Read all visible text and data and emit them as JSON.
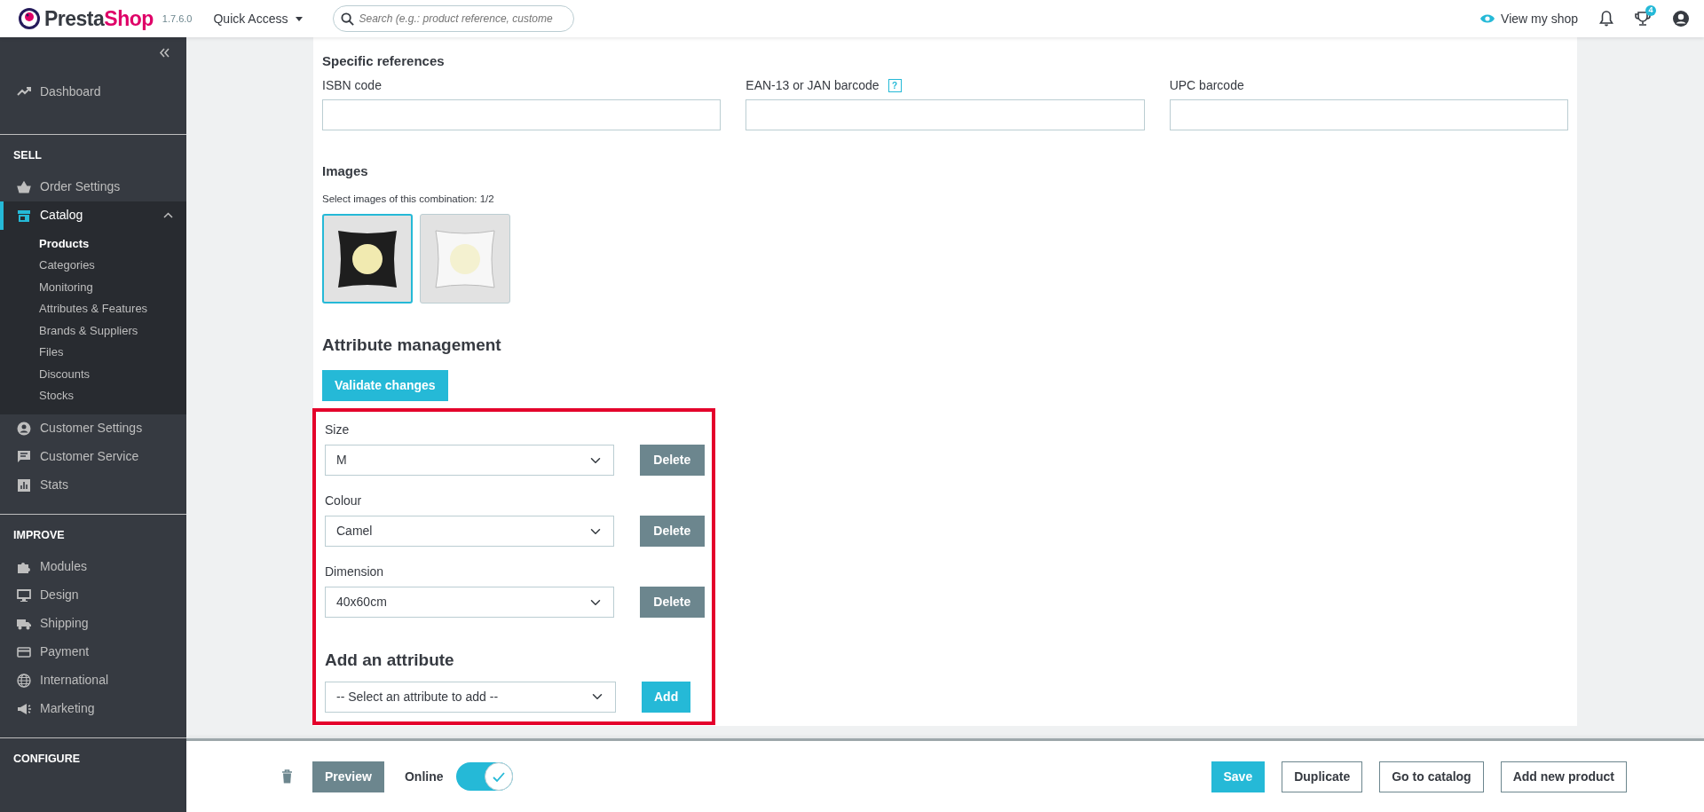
{
  "header": {
    "logo_text": "PrestaShop",
    "version": "1.7.6.0",
    "quick_access": "Quick Access",
    "search_placeholder": "Search (e.g.: product reference, custome",
    "view_shop": "View my shop",
    "trophy_count": "4"
  },
  "sidebar": {
    "sections": [
      {
        "items": [
          {
            "label": "Dashboard",
            "selected": false
          }
        ]
      },
      {
        "heading": "SELL",
        "items": [
          {
            "label": "Order Settings",
            "selected": false
          },
          {
            "label": "Catalog",
            "selected": true,
            "expanded": true,
            "children": [
              {
                "label": "Products",
                "selected": true
              },
              {
                "label": "Categories",
                "selected": false
              },
              {
                "label": "Monitoring",
                "selected": false
              },
              {
                "label": "Attributes & Features",
                "selected": false
              },
              {
                "label": "Brands & Suppliers",
                "selected": false
              },
              {
                "label": "Files",
                "selected": false
              },
              {
                "label": "Discounts",
                "selected": false
              },
              {
                "label": "Stocks",
                "selected": false
              }
            ]
          },
          {
            "label": "Customer Settings",
            "selected": false
          },
          {
            "label": "Customer Service",
            "selected": false
          },
          {
            "label": "Stats",
            "selected": false
          }
        ]
      },
      {
        "heading": "IMPROVE",
        "items": [
          {
            "label": "Modules",
            "selected": false
          },
          {
            "label": "Design",
            "selected": false
          },
          {
            "label": "Shipping",
            "selected": false
          },
          {
            "label": "Payment",
            "selected": false
          },
          {
            "label": "International",
            "selected": false
          },
          {
            "label": "Marketing",
            "selected": false
          }
        ]
      },
      {
        "heading": "CONFIGURE"
      }
    ]
  },
  "specific_references": {
    "title": "Specific references",
    "fields": [
      {
        "label": "ISBN code"
      },
      {
        "label": "EAN-13 or JAN barcode",
        "help": "?"
      },
      {
        "label": "UPC barcode"
      }
    ]
  },
  "images": {
    "title": "Images",
    "caption": "Select images of this combination: 1/2",
    "items": [
      {
        "selected": true
      },
      {
        "selected": false
      }
    ]
  },
  "attribute_management": {
    "title": "Attribute management",
    "validate_button": "Validate changes",
    "highlighted": true,
    "attributes": [
      {
        "label": "Size",
        "value": "M",
        "button": "Delete"
      },
      {
        "label": "Colour",
        "value": "Camel",
        "button": "Delete"
      },
      {
        "label": "Dimension",
        "value": "40x60cm",
        "button": "Delete"
      }
    ],
    "add": {
      "title": "Add an attribute",
      "value": "-- Select an attribute to add --",
      "button": "Add"
    }
  },
  "footer": {
    "preview": "Preview",
    "online_label": "Online",
    "online": true,
    "buttons": [
      {
        "label": "Save",
        "kind": "primary"
      },
      {
        "label": "Duplicate",
        "kind": "outline"
      },
      {
        "label": "Go to catalog",
        "kind": "outline"
      },
      {
        "label": "Add new product",
        "kind": "outline"
      }
    ]
  }
}
